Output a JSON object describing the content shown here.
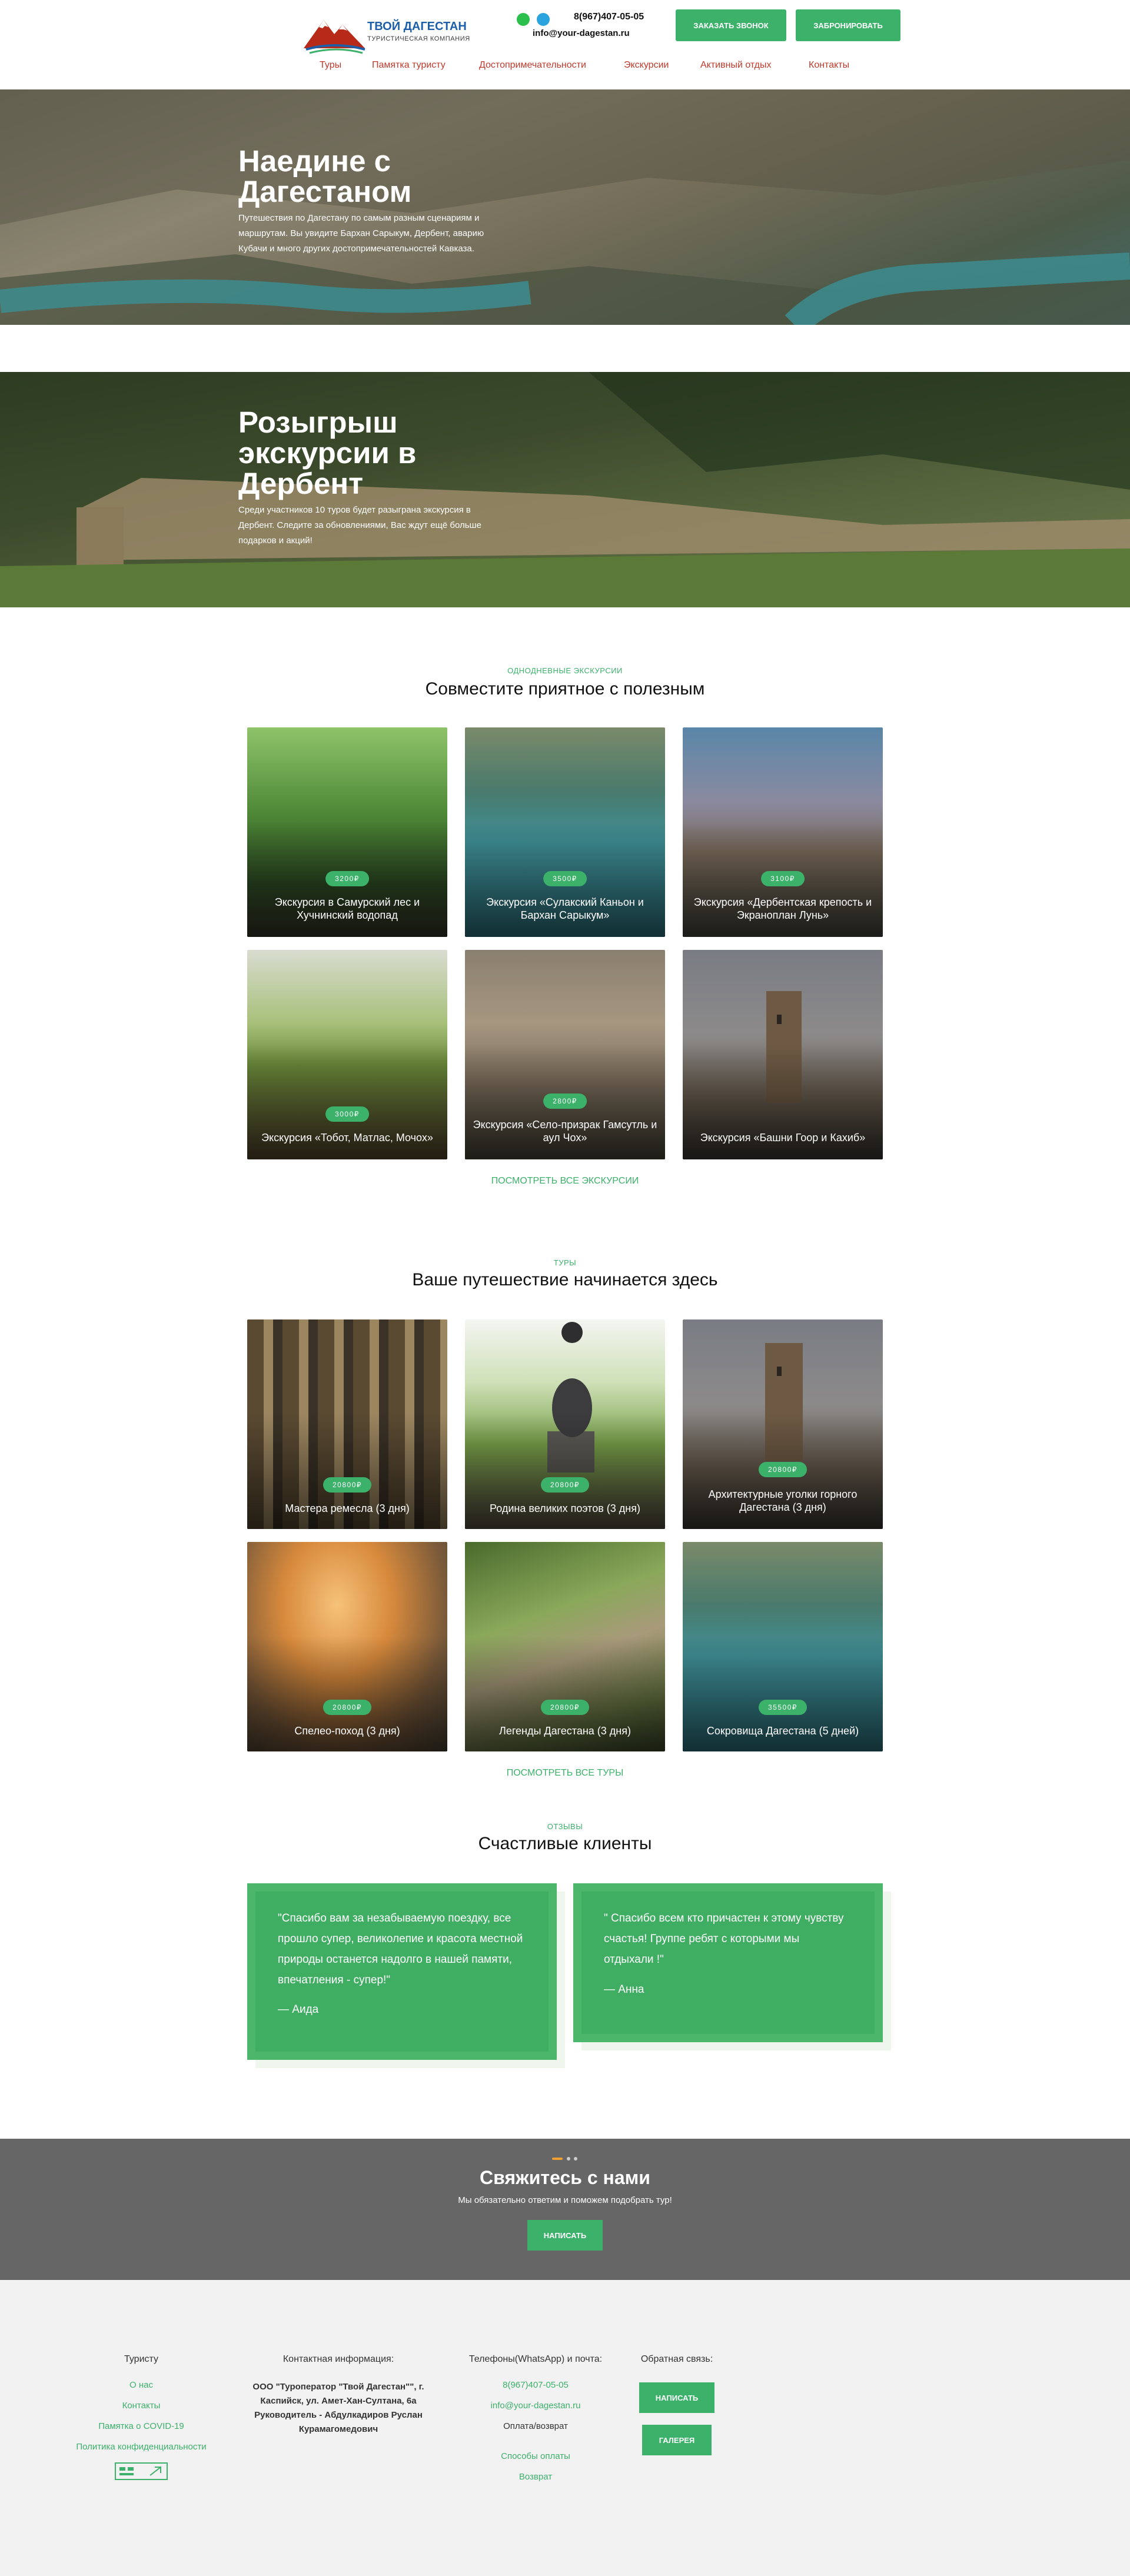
{
  "header": {
    "logo_name": "ТВОЙ ДАГЕСТАН",
    "logo_sub": "ТУРИСТИЧЕСКАЯ КОМПАНИЯ",
    "phone": "8(967)407-05-05",
    "email": "info@your-dagestan.ru",
    "btn_call": "ЗАКАЗАТЬ ЗВОНОК",
    "btn_book": "ЗАБРОНИРОВАТЬ",
    "nav": [
      "Туры",
      "Памятка туристу",
      "Достопримечательности",
      "Экскурсии",
      "Активный отдых",
      "Контакты"
    ]
  },
  "hero1": {
    "title": "Наедине с Дагестаном",
    "desc": "Путешествия по Дагестану по самым разным сценариям и маршрутам. Вы увидите Бархан Сарыкум, Дербент, аварию Кубачи и много других достопримечательностей Кавказа."
  },
  "hero2": {
    "title": "Розыгрыш экскурсии в Дербент",
    "desc": "Среди участников 10 туров будет разыграна экскурсия в Дербент. Следите за обновлениями, Вас ждут ещё больше подарков и акций!"
  },
  "excursions": {
    "eyebrow": "ОДНОДНЕВНЫЕ ЭКСКУРСИИ",
    "title": "Совместите приятное с полезным",
    "more": "ПОСМОТРЕТЬ ВСЕ ЭКСКУРСИИ",
    "items": [
      {
        "price": "3200₽",
        "title": "Экскурсия в Самурский лес и Хучнинский водопад"
      },
      {
        "price": "3500₽",
        "title": "Экскурсия «Сулакский Каньон и Бархан Сарыкум»"
      },
      {
        "price": "3100₽",
        "title": "Экскурсия «Дербентская крепость и Экраноплан Лунь»"
      },
      {
        "price": "3000₽",
        "title": "Экскурсия «Тобот, Матлас, Мочох»"
      },
      {
        "price": "2800₽",
        "title": "Экскурсия «Село-призрак Гамсутль и аул Чох»"
      },
      {
        "price": "",
        "title": "Экскурсия «Башни Гоор и Кахиб»"
      }
    ]
  },
  "tours": {
    "eyebrow": "ТУРЫ",
    "title": "Ваше путешествие начинается здесь",
    "more": "ПОСМОТРЕТЬ ВСЕ ТУРЫ",
    "items": [
      {
        "price": "20800₽",
        "title": "Мастера ремесла (3 дня)"
      },
      {
        "price": "20800₽",
        "title": "Родина великих поэтов (3 дня)"
      },
      {
        "price": "20800₽",
        "title": "Архитектурные уголки горного Дагестана (3 дня)"
      },
      {
        "price": "20800₽",
        "title": "Спелео-поход (3 дня)"
      },
      {
        "price": "20800₽",
        "title": "Легенды Дагестана (3 дня)"
      },
      {
        "price": "35500₽",
        "title": "Сокровища Дагестана (5 дней)"
      }
    ]
  },
  "reviews": {
    "eyebrow": "ОТЗЫВЫ",
    "title": "Счастливые клиенты",
    "items": [
      {
        "text": "\"Спасибо вам за незабываемую поездку, все прошло супер, великолепие и красота местной природы останется надолго в нашей памяти, впечатления - супер!\"",
        "author": "— Аида"
      },
      {
        "text": "\" Спасибо всем кто причастен к этому чувству счастья! Группе ребят с которыми мы отдыхали !\"",
        "author": "— Анна"
      }
    ]
  },
  "contact": {
    "title": "Свяжитесь с нами",
    "subtitle": "Мы обязательно ответим и поможем подобрать тур!",
    "button": "НАПИСАТЬ"
  },
  "footer": {
    "col1_title": "Туристу",
    "col1_links": [
      "О нас",
      "Контакты",
      "Памятка о COVID-19",
      "Политика конфиденциальности"
    ],
    "col2_title": "Контактная информация:",
    "col2_text": "ООО \"Туроператор \"Твой Дагестан\"\", г. Каспийск, ул. Амет-Хан-Султана, 6а Руководитель - Абдулкадиров Руслан Курамагомедович",
    "col3_title": "Телефоны(WhatsApp) и почта:",
    "col3_phone": "8(967)407-05-05",
    "col3_email": "info@your-dagestan.ru",
    "col3_sub": "Оплата/возврат",
    "col3_links": [
      "Способы оплаты",
      "Возврат"
    ],
    "col4_title": "Обратная связь:",
    "col4_btn1": "НАПИСАТЬ",
    "col4_btn2": "ГАЛЕРЕЯ"
  },
  "colors": {
    "accent": "#3bb16a",
    "nav": "#c0392b",
    "contact_bg": "#666666",
    "footer_bg": "#f2f2f2"
  }
}
